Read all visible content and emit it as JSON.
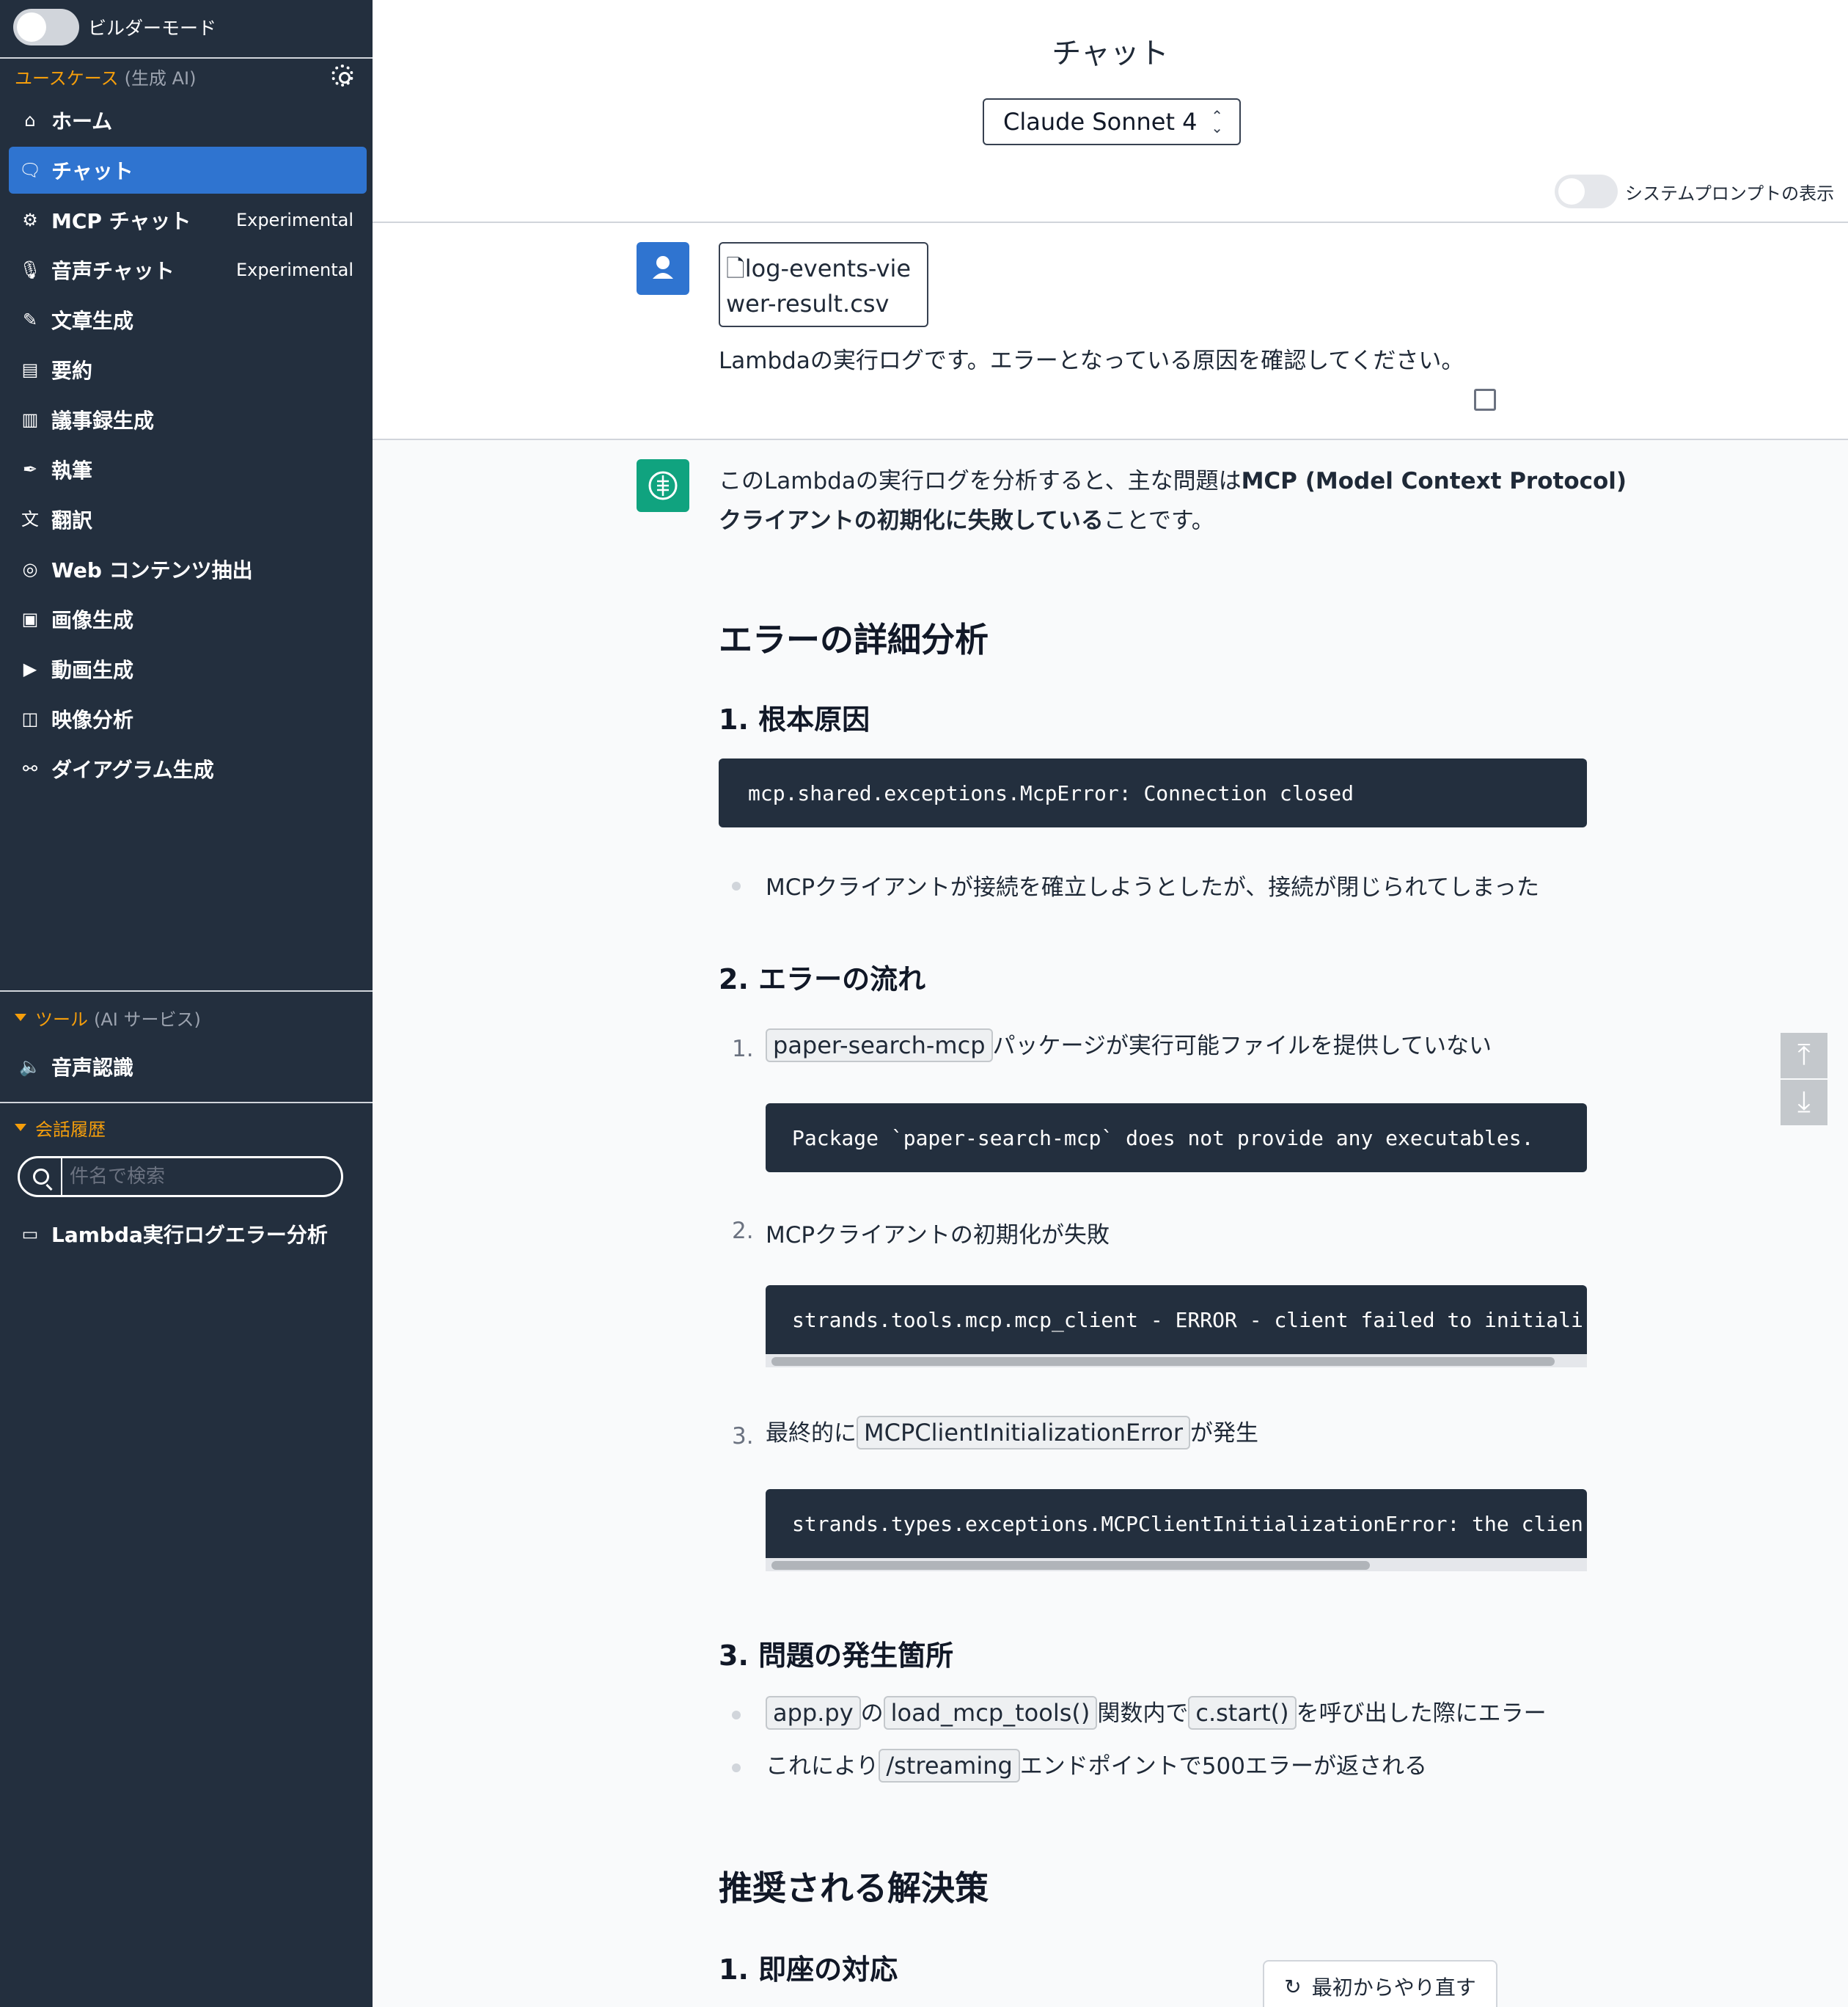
{
  "sidebar": {
    "builder_mode_label": "ビルダーモード",
    "usecase_title": "ユースケース",
    "usecase_sub": "(生成 AI)",
    "items": [
      {
        "label": "ホーム",
        "icon": "home-icon",
        "glyph": "⌂"
      },
      {
        "label": "チャット",
        "icon": "chat-icon",
        "glyph": "🗨"
      },
      {
        "label": "MCP チャット",
        "icon": "mcp-icon",
        "glyph": "⚙",
        "badge": "Experimental"
      },
      {
        "label": "音声チャット",
        "icon": "mic-icon",
        "glyph": "🎙",
        "badge": "Experimental"
      },
      {
        "label": "文章生成",
        "icon": "pencil-icon",
        "glyph": "✎"
      },
      {
        "label": "要約",
        "icon": "summary-icon",
        "glyph": "▤"
      },
      {
        "label": "議事録生成",
        "icon": "minutes-icon",
        "glyph": "▥"
      },
      {
        "label": "執筆",
        "icon": "pen-icon",
        "glyph": "✒"
      },
      {
        "label": "翻訳",
        "icon": "translate-icon",
        "glyph": "文"
      },
      {
        "label": "Web コンテンツ抽出",
        "icon": "globe-icon",
        "glyph": "◎"
      },
      {
        "label": "画像生成",
        "icon": "image-icon",
        "glyph": "▣"
      },
      {
        "label": "動画生成",
        "icon": "video-gen-icon",
        "glyph": "▶"
      },
      {
        "label": "映像分析",
        "icon": "camera-icon",
        "glyph": "◫"
      },
      {
        "label": "ダイアグラム生成",
        "icon": "diagram-icon",
        "glyph": "⚯"
      }
    ],
    "tools_title": "ツール",
    "tools_sub": "(AI サービス)",
    "tools_items": [
      {
        "label": "音声認識",
        "icon": "speaker-icon",
        "glyph": "🔈"
      }
    ],
    "history_title": "会話履歴",
    "search_placeholder": "件名で検索",
    "history_items": [
      {
        "label": "Lambda実行ログエラー分析"
      }
    ]
  },
  "header": {
    "title": "チャット",
    "model": "Claude Sonnet 4",
    "system_prompt_label": "システムプロンプトの表示"
  },
  "user_message": {
    "file_name_1": "log-events-vie",
    "file_name_2": "wer-result.csv",
    "text": "Lambdaの実行ログです。エラーとなっている原因を確認してください。"
  },
  "assistant": {
    "intro_1a": "このLambdaの実行ログを分析すると、主な問題は",
    "intro_1b": "MCP (Model Context Protocol)",
    "intro_2a": "クライアントの初期化に失敗している",
    "intro_2b": "ことです。",
    "h_error_analysis": "エラーの詳細分析",
    "h_root_cause": "1. 根本原因",
    "code_root": "mcp.shared.exceptions.McpError: Connection closed",
    "bullet_root": "MCPクライアントが接続を確立しようとしたが、接続が閉じられてしまった",
    "h_flow": "2. エラーの流れ",
    "flow_1_num": "1.",
    "flow_1_code": "paper-search-mcp",
    "flow_1_text": "パッケージが実行可能ファイルを提供していない",
    "code_flow_1": "Package `paper-search-mcp` does not provide any executables.",
    "flow_2_num": "2.",
    "flow_2_text": "MCPクライアントの初期化が失敗",
    "code_flow_2": "strands.tools.mcp.mcp_client - ERROR - client failed to initiali",
    "flow_3_num": "3.",
    "flow_3_pre": "最終的に",
    "flow_3_code": "MCPClientInitializationError",
    "flow_3_post": "が発生",
    "code_flow_3": "strands.types.exceptions.MCPClientInitializationError: the clien",
    "h_location": "3. 問題の発生箇所",
    "loc_1_code_a": "app.py",
    "loc_1_t1": "の",
    "loc_1_code_b": "load_mcp_tools()",
    "loc_1_t2": "関数内で",
    "loc_1_code_c": "c.start()",
    "loc_1_t3": "を呼び出した際にエラー",
    "loc_2_t1": "これにより",
    "loc_2_code": "/streaming",
    "loc_2_t2": "エンドポイントで500エラーが返される",
    "h_solution": "推奨される解決策",
    "h_immediate": "1. 即座の対応"
  },
  "retry_label": "最初からやり直す",
  "colors": {
    "sidebar_bg": "#232f3e",
    "accent": "#f59e0b",
    "active": "#2f74d0",
    "bot_avatar": "#10a37f"
  }
}
